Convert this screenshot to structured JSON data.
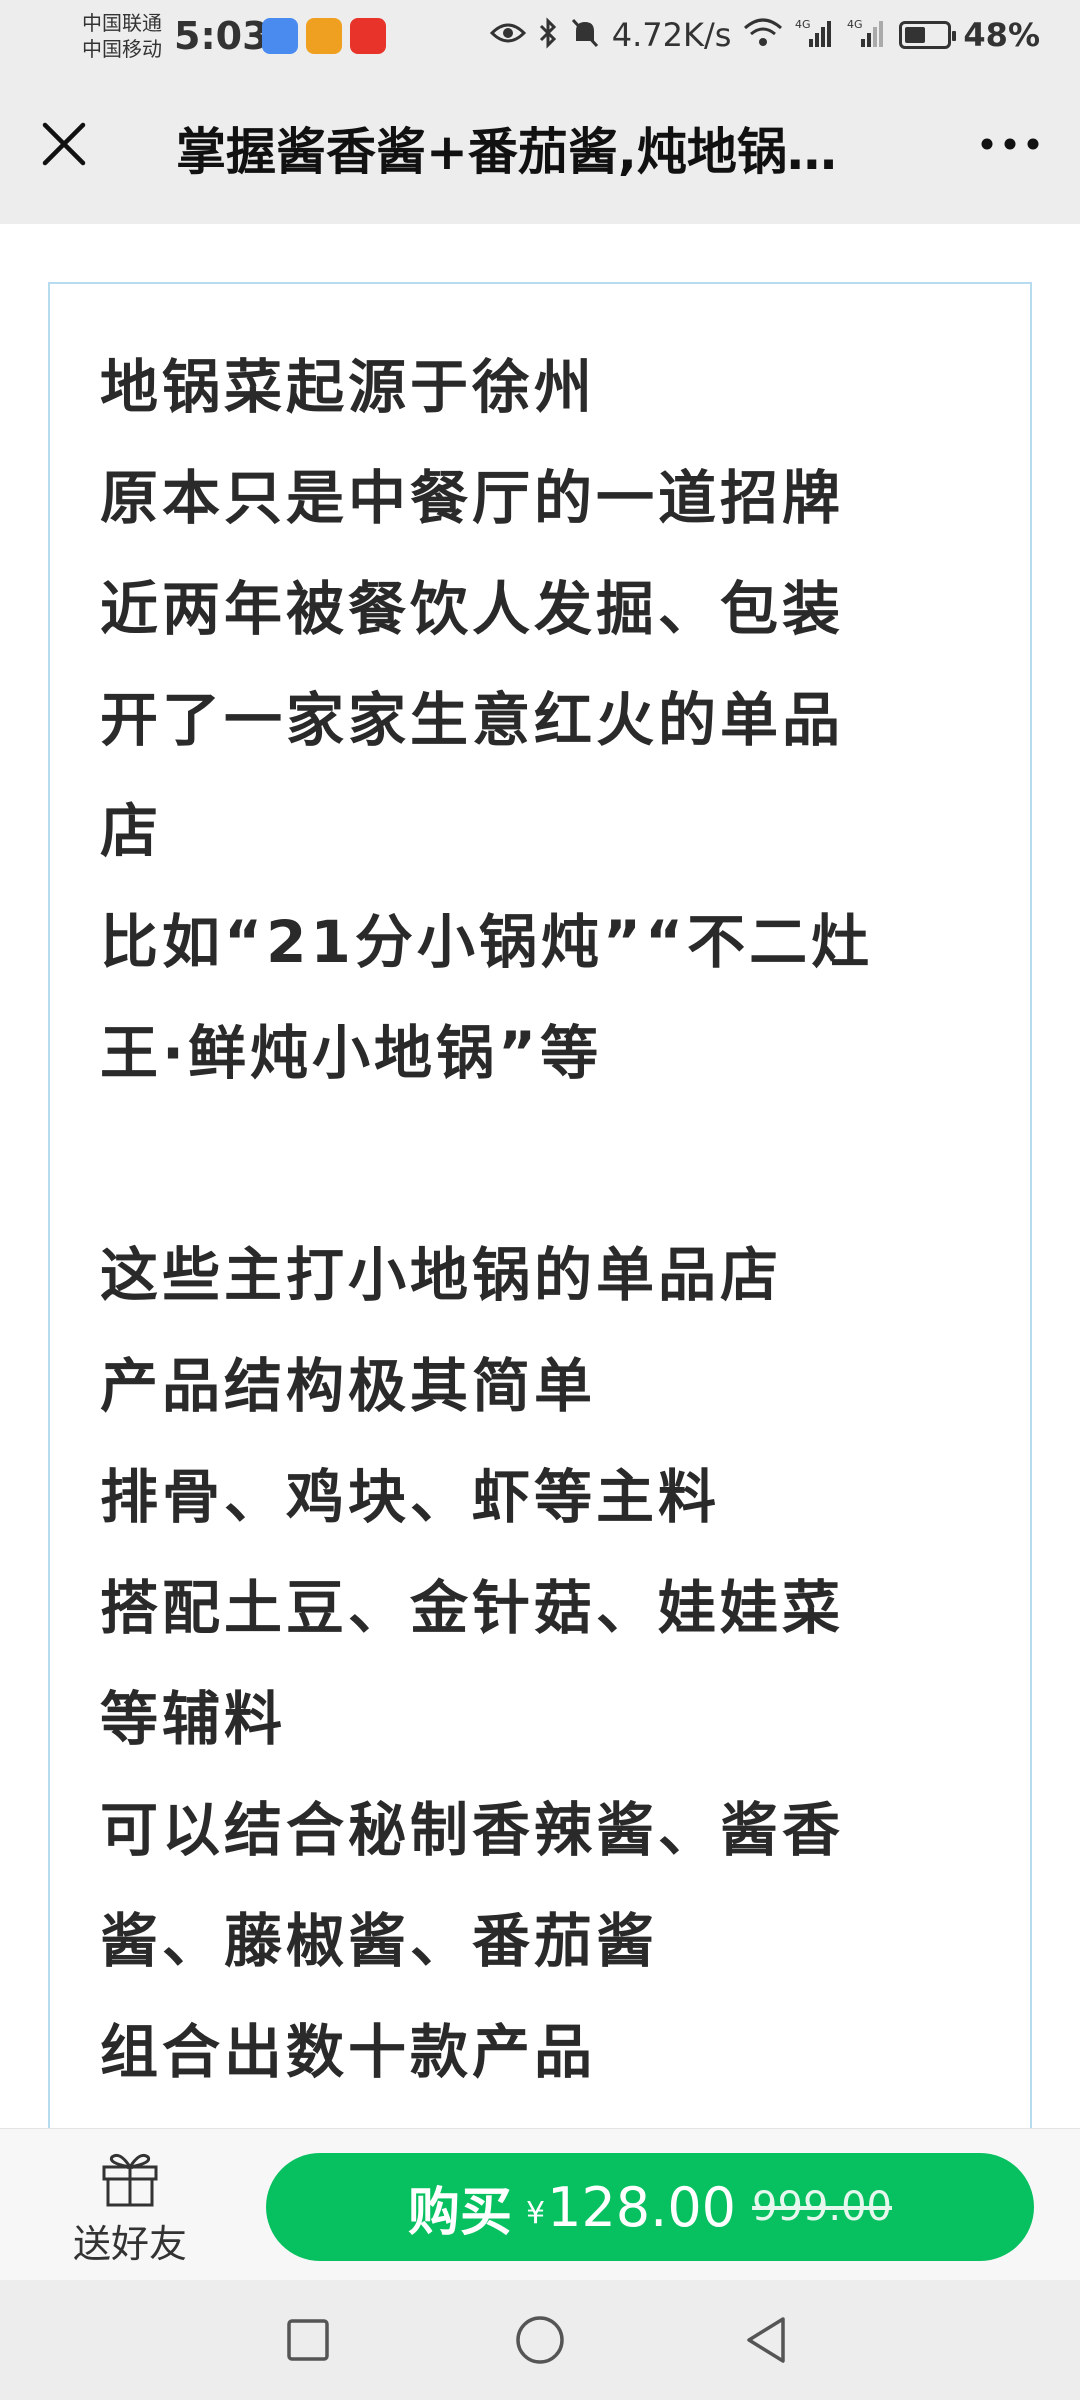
{
  "status_bar": {
    "carrier_1": "中国联通",
    "carrier_2": "中国移动",
    "time": "5:03",
    "net_speed": "4.72K/s",
    "signal_1_label": "4G",
    "signal_2_label": "4G",
    "battery_percent": "48%",
    "battery_level": 0.48,
    "icons": [
      "eye-icon",
      "bluetooth-icon",
      "mute-bell-icon",
      "wifi-icon",
      "signal-icon",
      "signal-icon",
      "battery-icon"
    ],
    "badge_colors": [
      "#4a8bf0",
      "#f0a020",
      "#e8332a"
    ]
  },
  "title_bar": {
    "title": "掌握酱香酱+番茄酱,炖地锅…",
    "close_icon": "close-icon",
    "more_icon": "more-dots-icon"
  },
  "article": {
    "border_color": "#b7dcef",
    "lines": [
      "地锅菜起源于徐州",
      "原本只是中餐厅的一道招牌",
      "近两年被餐饮人发掘、包装",
      "开了一家家生意红火的单品",
      "店",
      "比如“21分小锅炖”“不二灶",
      "王·鲜炖小地锅”等",
      "",
      "这些主打小地锅的单品店",
      "产品结构极其简单",
      "排骨、鸡块、虾等主料",
      "搭配土豆、金针菇、娃娃菜",
      "等辅料",
      "可以结合秘制香辣酱、酱香",
      "酱、藤椒酱、番茄酱",
      "组合出数十款产品"
    ]
  },
  "action_bar": {
    "gift_label": "送好友",
    "gift_icon": "gift-icon",
    "buy_label": "购买",
    "currency_symbol": "¥",
    "price": "128.00",
    "original_price": "999.00",
    "buy_color": "#07c160"
  },
  "nav_bar": {
    "icons": [
      "recent-apps-icon",
      "home-icon",
      "back-icon"
    ]
  }
}
